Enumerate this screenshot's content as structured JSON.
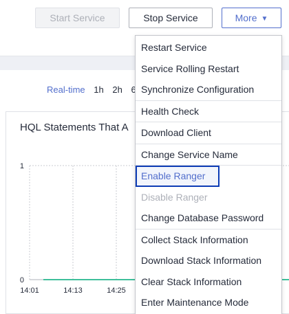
{
  "toolbar": {
    "start_label": "Start Service",
    "stop_label": "Stop Service",
    "more_label": "More",
    "more_caret": "▼"
  },
  "time_range": {
    "options": [
      "Real-time",
      "1h",
      "2h",
      "6"
    ],
    "selected": "Real-time"
  },
  "chart": {
    "title": "HQL Statements That A"
  },
  "chart_data": {
    "type": "line",
    "title": "HQL Statements That A",
    "xlabel": "",
    "ylabel": "",
    "x": [
      "14:01",
      "14:13",
      "14:25"
    ],
    "yticks": [
      "0",
      "1"
    ],
    "ylim": [
      0,
      1
    ],
    "grid": true,
    "series": [
      {
        "values": [
          0,
          0,
          0
        ],
        "color": "#3ebf9b"
      }
    ]
  },
  "menu": {
    "groups": [
      [
        "Restart Service",
        "Service Rolling Restart",
        "Synchronize Configuration"
      ],
      [
        "Health Check"
      ],
      [
        "Download Client"
      ],
      [
        "Change Service Name"
      ],
      [
        "Enable Ranger",
        "Disable Ranger",
        "Change Database Password"
      ],
      [
        "Collect Stack Information",
        "Download Stack Information",
        "Clear Stack Information",
        "Enter Maintenance Mode"
      ]
    ],
    "focused_item": "Enable Ranger",
    "disabled_items": [
      "Disable Ranger"
    ]
  },
  "colors": {
    "accent": "#526ecc",
    "focus_outline": "#0c3bb5",
    "disabled_text": "#adb0b8",
    "series_line": "#3ebf9b"
  }
}
